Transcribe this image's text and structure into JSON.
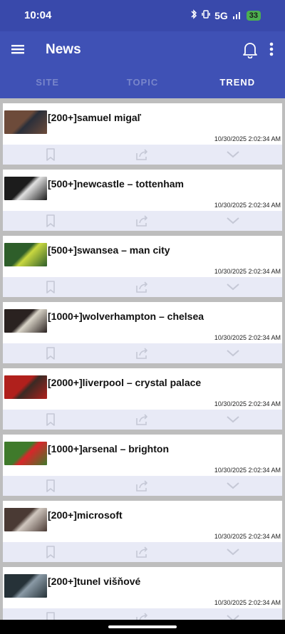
{
  "status": {
    "time": "10:04",
    "network": "5G",
    "battery": "33"
  },
  "app": {
    "title": "News"
  },
  "tabs": [
    {
      "label": "SITE",
      "active": false
    },
    {
      "label": "TOPIC",
      "active": false
    },
    {
      "label": "TREND",
      "active": true
    }
  ],
  "articles": [
    {
      "title": "[200+]samuel migaľ",
      "time": "10/30/2025 2:02:34 AM",
      "thumb_colors": [
        "#6d4b3a",
        "#2b2f3a"
      ]
    },
    {
      "title": "[500+]newcastle – tottenham",
      "time": "10/30/2025 2:02:34 AM",
      "thumb_colors": [
        "#1c1c1c",
        "#e0e0e0"
      ]
    },
    {
      "title": "[500+]swansea – man city",
      "time": "10/30/2025 2:02:34 AM",
      "thumb_colors": [
        "#2e5e2a",
        "#c9d840"
      ]
    },
    {
      "title": "[1000+]wolverhampton – chelsea",
      "time": "10/30/2025 2:02:34 AM",
      "thumb_colors": [
        "#2a2220",
        "#d9d4c8"
      ]
    },
    {
      "title": "[2000+]liverpool – crystal palace",
      "time": "10/30/2025 2:02:34 AM",
      "thumb_colors": [
        "#b0201c",
        "#3a2a24"
      ]
    },
    {
      "title": "[1000+]arsenal – brighton",
      "time": "10/30/2025 2:02:34 AM",
      "thumb_colors": [
        "#3f7a2b",
        "#d8262a"
      ]
    },
    {
      "title": "[200+]microsoft",
      "time": "10/30/2025 2:02:34 AM",
      "thumb_colors": [
        "#4a3a34",
        "#cfc6be"
      ]
    },
    {
      "title": "[200+]tunel višňové",
      "time": "10/30/2025 2:02:34 AM",
      "thumb_colors": [
        "#263238",
        "#8a9aa6"
      ]
    }
  ],
  "colors": {
    "primary": "#3f51b5",
    "status_bar": "#3949ab",
    "action_bar": "#e8eaf6",
    "inactive_tab": "#7986cb",
    "battery": "#4caf50"
  },
  "icons": {
    "menu": "hamburger-menu-icon",
    "notifications": "bell-icon",
    "more": "more-vertical-icon",
    "bookmark": "bookmark-icon",
    "share": "share-icon",
    "expand": "chevron-down-icon"
  }
}
